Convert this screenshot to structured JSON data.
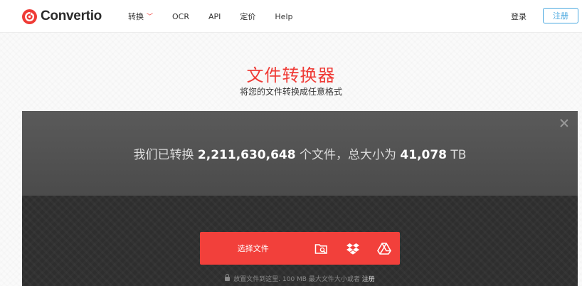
{
  "header": {
    "logo_text": "Convertio",
    "nav": [
      {
        "label": "转换",
        "has_dropdown": true
      },
      {
        "label": "OCR"
      },
      {
        "label": "API"
      },
      {
        "label": "定价"
      },
      {
        "label": "Help"
      }
    ],
    "login_label": "登录",
    "signup_label": "注册"
  },
  "hero": {
    "title": "文件转换器",
    "subtitle": "将您的文件转换成任意格式"
  },
  "stats": {
    "prefix": "我们已转换",
    "files_count": "2,211,630,648",
    "middle": "个文件，总大小为",
    "total_size": "41,078",
    "unit": "TB"
  },
  "upload": {
    "choose_label": "选择文件",
    "icons": [
      "folder-search-icon",
      "dropbox-icon",
      "google-drive-icon"
    ],
    "hint_text": "放置文件到这里. 100 MB 最大文件大小或者",
    "hint_link": "注册"
  },
  "colors": {
    "brand_red": "#ef3b36",
    "signup_blue": "#4aa8e0",
    "panel_dark": "#2e2e2e"
  }
}
